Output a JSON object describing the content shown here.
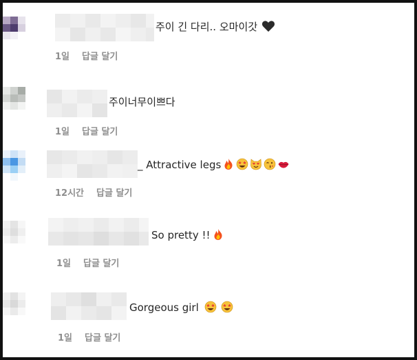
{
  "comments": [
    {
      "text": "주이 긴 다리.. 오마이갓",
      "emojis": [
        "black-heart"
      ],
      "time": "1일",
      "reply_label": "답글 달기"
    },
    {
      "text": "주이너무이쁘다",
      "emojis": [],
      "time": "1일",
      "reply_label": "답글 달기"
    },
    {
      "text": "_ Attractive legs",
      "emojis": [
        "fire",
        "star-struck",
        "smiling-cat-heart-eyes",
        "winking-kiss",
        "kiss-lips"
      ],
      "time": "12시간",
      "reply_label": "답글 달기"
    },
    {
      "text": "So pretty !!",
      "emojis": [
        "fire"
      ],
      "time": "1일",
      "reply_label": "답글 달기"
    },
    {
      "text": "Gorgeous girl",
      "emojis": [
        "star-struck",
        "star-struck"
      ],
      "time": "1일",
      "reply_label": "답글 달기"
    }
  ],
  "colors": {
    "text": "#262626",
    "meta": "#8e8e8e",
    "border": "#111111"
  }
}
